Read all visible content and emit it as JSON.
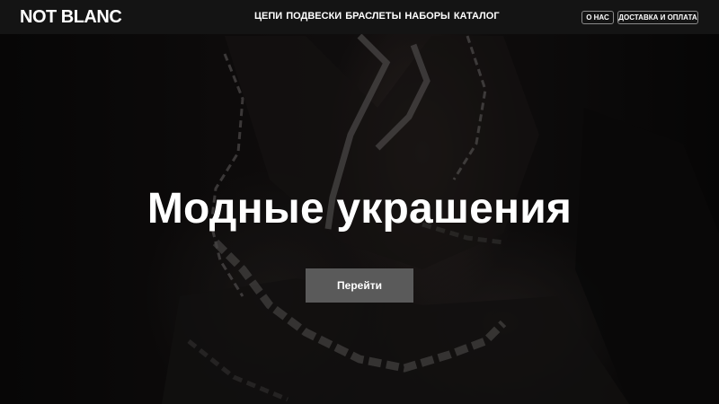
{
  "brand": {
    "logo_text": "NOT BLANC"
  },
  "nav": {
    "items": [
      {
        "label": "ЦЕПИ"
      },
      {
        "label": "ПОДВЕСКИ"
      },
      {
        "label": "БРАСЛЕТЫ"
      },
      {
        "label": "НАБОРЫ"
      },
      {
        "label": "КАТАЛОГ"
      }
    ]
  },
  "header_buttons": {
    "about": "О НАС",
    "delivery": "ДОСТАВКА И ОПЛАТА"
  },
  "hero": {
    "headline": "Модные украшения",
    "cta_label": "Перейти"
  },
  "colors": {
    "topbar_bg": "#141414",
    "cta_bg": "#5a5a5a",
    "text": "#ffffff"
  }
}
